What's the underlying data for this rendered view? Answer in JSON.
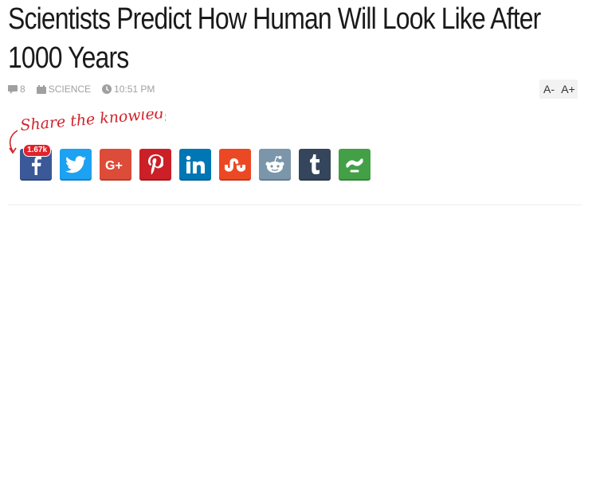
{
  "article": {
    "title": "Scientists Predict How Human Will Look Like After 1000 Years"
  },
  "meta": {
    "comments_count": "8",
    "category": "SCIENCE",
    "time": "10:51 PM"
  },
  "font_size": {
    "decrease_label": "A-",
    "increase_label": "A+"
  },
  "share": {
    "label": "Share the knowledge!",
    "facebook_count": "1.67k",
    "buttons": [
      {
        "network": "facebook",
        "color": "#3b5998",
        "icon": "facebook-icon"
      },
      {
        "network": "twitter",
        "color": "#1da1f2",
        "icon": "twitter-icon"
      },
      {
        "network": "google-plus",
        "color": "#dd4b39",
        "icon": "google-plus-icon"
      },
      {
        "network": "pinterest",
        "color": "#cb2027",
        "icon": "pinterest-icon"
      },
      {
        "network": "linkedin",
        "color": "#0077b5",
        "icon": "linkedin-icon"
      },
      {
        "network": "stumbleupon",
        "color": "#eb4924",
        "icon": "stumbleupon-icon"
      },
      {
        "network": "reddit",
        "color": "#7b96aa",
        "icon": "reddit-icon"
      },
      {
        "network": "tumblr",
        "color": "#35465c",
        "icon": "tumblr-icon"
      },
      {
        "network": "more",
        "color": "#43a047",
        "icon": "more-share-icon"
      }
    ]
  },
  "colors": {
    "share_label": "#d0232b",
    "meta_text": "#a0a0a0"
  }
}
